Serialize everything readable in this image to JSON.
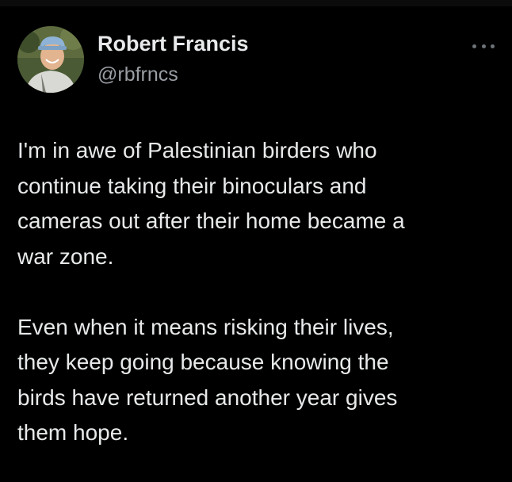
{
  "author": {
    "name": "Robert Francis",
    "handle": "@rbfrncs",
    "avatar_icon": "user-avatar-photo"
  },
  "more_icon": "ellipsis-icon",
  "tweet": {
    "paragraphs": [
      "I'm in awe of Palestinian birders who\ncontinue taking their binoculars and\ncameras out after their home became a\nwar zone.",
      "Even when it means risking their lives,\nthey keep going because knowing the\nbirds have returned another year gives\nthem hope."
    ]
  },
  "colors": {
    "background": "#000000",
    "text_primary": "#e7e9ea",
    "text_secondary": "#9a9ea3"
  }
}
